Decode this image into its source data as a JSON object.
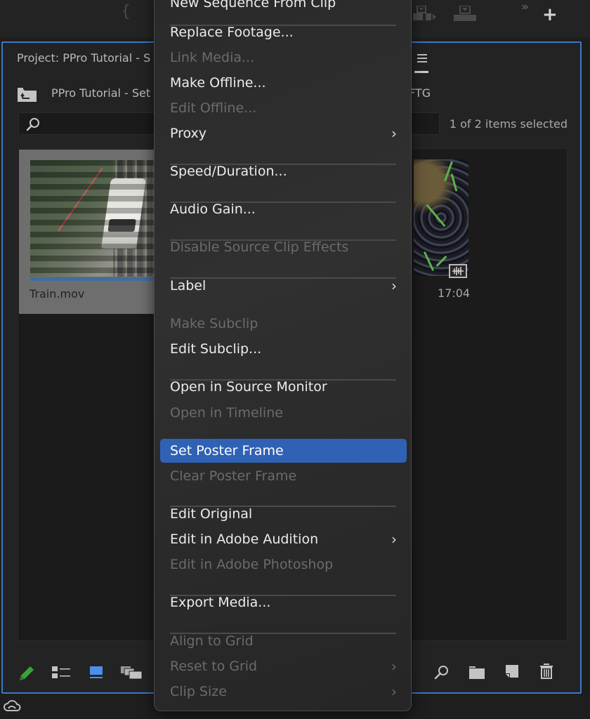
{
  "toolbar": {
    "icons": [
      "brace-icon",
      "overwrite-icon",
      "insert-icon",
      "more-chevrons-icon",
      "add-icon"
    ],
    "more_glyph": "»",
    "add_glyph": "+"
  },
  "project_panel": {
    "title": "Project: PPro Tutorial - S",
    "bin_path": "PPro Tutorial - Set",
    "bin_path_tail": "FTG",
    "search": {
      "value": "",
      "placeholder": ""
    },
    "selection_status": "1 of 2 items selected",
    "clips": [
      {
        "name": "Train.mov",
        "selected": true,
        "progress": 1.0
      },
      {
        "name": "",
        "duration": "17:04",
        "has_audio": true
      }
    ],
    "bottom_toolbar": [
      "write-lock-pencil-icon",
      "list-view-icon",
      "icon-view-icon",
      "freeform-view-icon",
      "find-icon",
      "new-bin-icon",
      "new-item-icon",
      "trash-icon"
    ]
  },
  "context_menu": {
    "partial_top_item": "New Sequence From Clip",
    "items": [
      {
        "label": "Replace Footage...",
        "enabled": true
      },
      {
        "label": "Link Media...",
        "enabled": false
      },
      {
        "label": "Make Offline...",
        "enabled": true
      },
      {
        "label": "Edit Offline...",
        "enabled": false
      },
      {
        "label": "Proxy",
        "enabled": true,
        "submenu": true
      },
      {
        "label": "Speed/Duration...",
        "enabled": true
      },
      {
        "label": "Audio Gain...",
        "enabled": true
      },
      {
        "label": "Disable Source Clip Effects",
        "enabled": false
      },
      {
        "label": "Label",
        "enabled": true,
        "submenu": true
      },
      {
        "label": "Make Subclip",
        "enabled": false
      },
      {
        "label": "Edit Subclip...",
        "enabled": true
      },
      {
        "label": "Open in Source Monitor",
        "enabled": true
      },
      {
        "label": "Open in Timeline",
        "enabled": false
      },
      {
        "label": "Set Poster Frame",
        "enabled": true,
        "highlighted": true
      },
      {
        "label": "Clear Poster Frame",
        "enabled": false
      },
      {
        "label": "Edit Original",
        "enabled": true
      },
      {
        "label": "Edit in Adobe Audition",
        "enabled": true,
        "submenu": true
      },
      {
        "label": "Edit in Adobe Photoshop",
        "enabled": false
      },
      {
        "label": "Export Media...",
        "enabled": true
      },
      {
        "label": "Align to Grid",
        "enabled": false
      },
      {
        "label": "Reset to Grid",
        "enabled": false,
        "submenu": true
      },
      {
        "label": "Clip Size",
        "enabled": false,
        "submenu": true
      }
    ],
    "chevron_glyph": "›"
  },
  "colors": {
    "accent_blue": "#3b79c9",
    "menu_highlight": "#2f62b5",
    "pencil_green": "#3aa33a"
  }
}
